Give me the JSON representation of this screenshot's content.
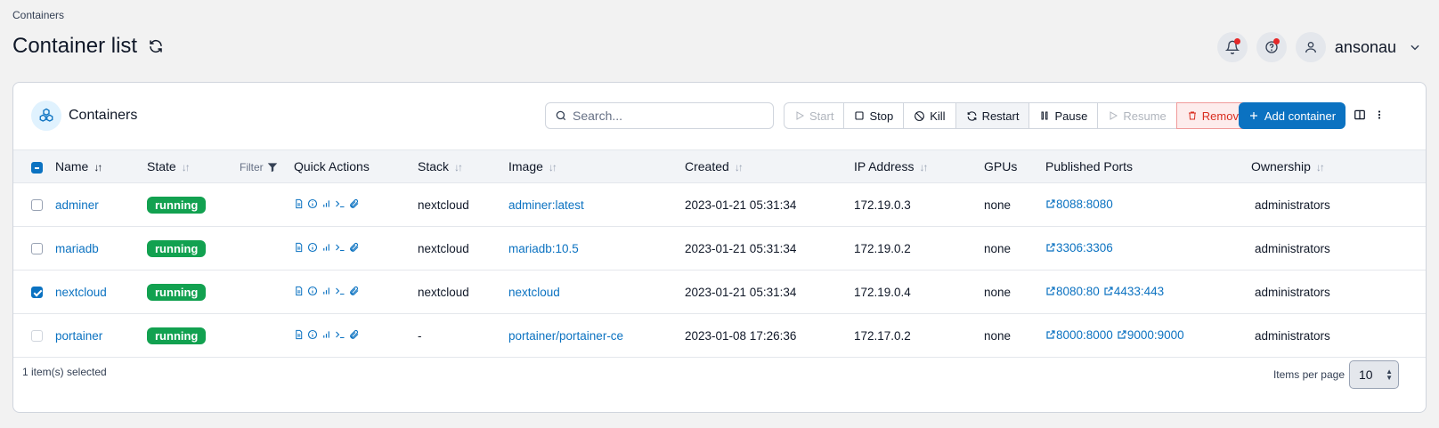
{
  "breadcrumb": "Containers",
  "page_title": "Container list",
  "user": {
    "name": "ansonau"
  },
  "panel": {
    "title": "Containers",
    "search_placeholder": "Search...",
    "actions": {
      "start": "Start",
      "stop": "Stop",
      "kill": "Kill",
      "restart": "Restart",
      "pause": "Pause",
      "resume": "Resume",
      "remove": "Remove",
      "add": "Add container"
    }
  },
  "columns": {
    "name": "Name",
    "state": "State",
    "filter": "Filter",
    "quick_actions": "Quick Actions",
    "stack": "Stack",
    "image": "Image",
    "created": "Created",
    "ip": "IP Address",
    "gpus": "GPUs",
    "ports": "Published Ports",
    "ownership": "Ownership"
  },
  "rows": [
    {
      "name": "adminer",
      "state": "running",
      "stack": "nextcloud",
      "image": "adminer:latest",
      "created": "2023-01-21 05:31:34",
      "ip": "172.19.0.3",
      "gpus": "none",
      "ports": [
        "8088:8080"
      ],
      "ownership": "administrators",
      "checked": false
    },
    {
      "name": "mariadb",
      "state": "running",
      "stack": "nextcloud",
      "image": "mariadb:10.5",
      "created": "2023-01-21 05:31:34",
      "ip": "172.19.0.2",
      "gpus": "none",
      "ports": [
        "3306:3306"
      ],
      "ownership": "administrators",
      "checked": false
    },
    {
      "name": "nextcloud",
      "state": "running",
      "stack": "nextcloud",
      "image": "nextcloud",
      "created": "2023-01-21 05:31:34",
      "ip": "172.19.0.4",
      "gpus": "none",
      "ports": [
        "8080:80",
        "4433:443"
      ],
      "ownership": "administrators",
      "checked": true
    },
    {
      "name": "portainer",
      "state": "running",
      "stack": "-",
      "image": "portainer/portainer-ce",
      "created": "2023-01-08 17:26:36",
      "ip": "172.17.0.2",
      "gpus": "none",
      "ports": [
        "8000:8000",
        "9000:9000"
      ],
      "ownership": "administrators",
      "checked": false
    }
  ],
  "footer": {
    "selected": "1 item(s) selected",
    "items_per_page_label": "Items per page",
    "items_per_page": "10"
  },
  "colors": {
    "accent": "#0b72c1",
    "running": "#12a150",
    "danger": "#d92d20"
  }
}
